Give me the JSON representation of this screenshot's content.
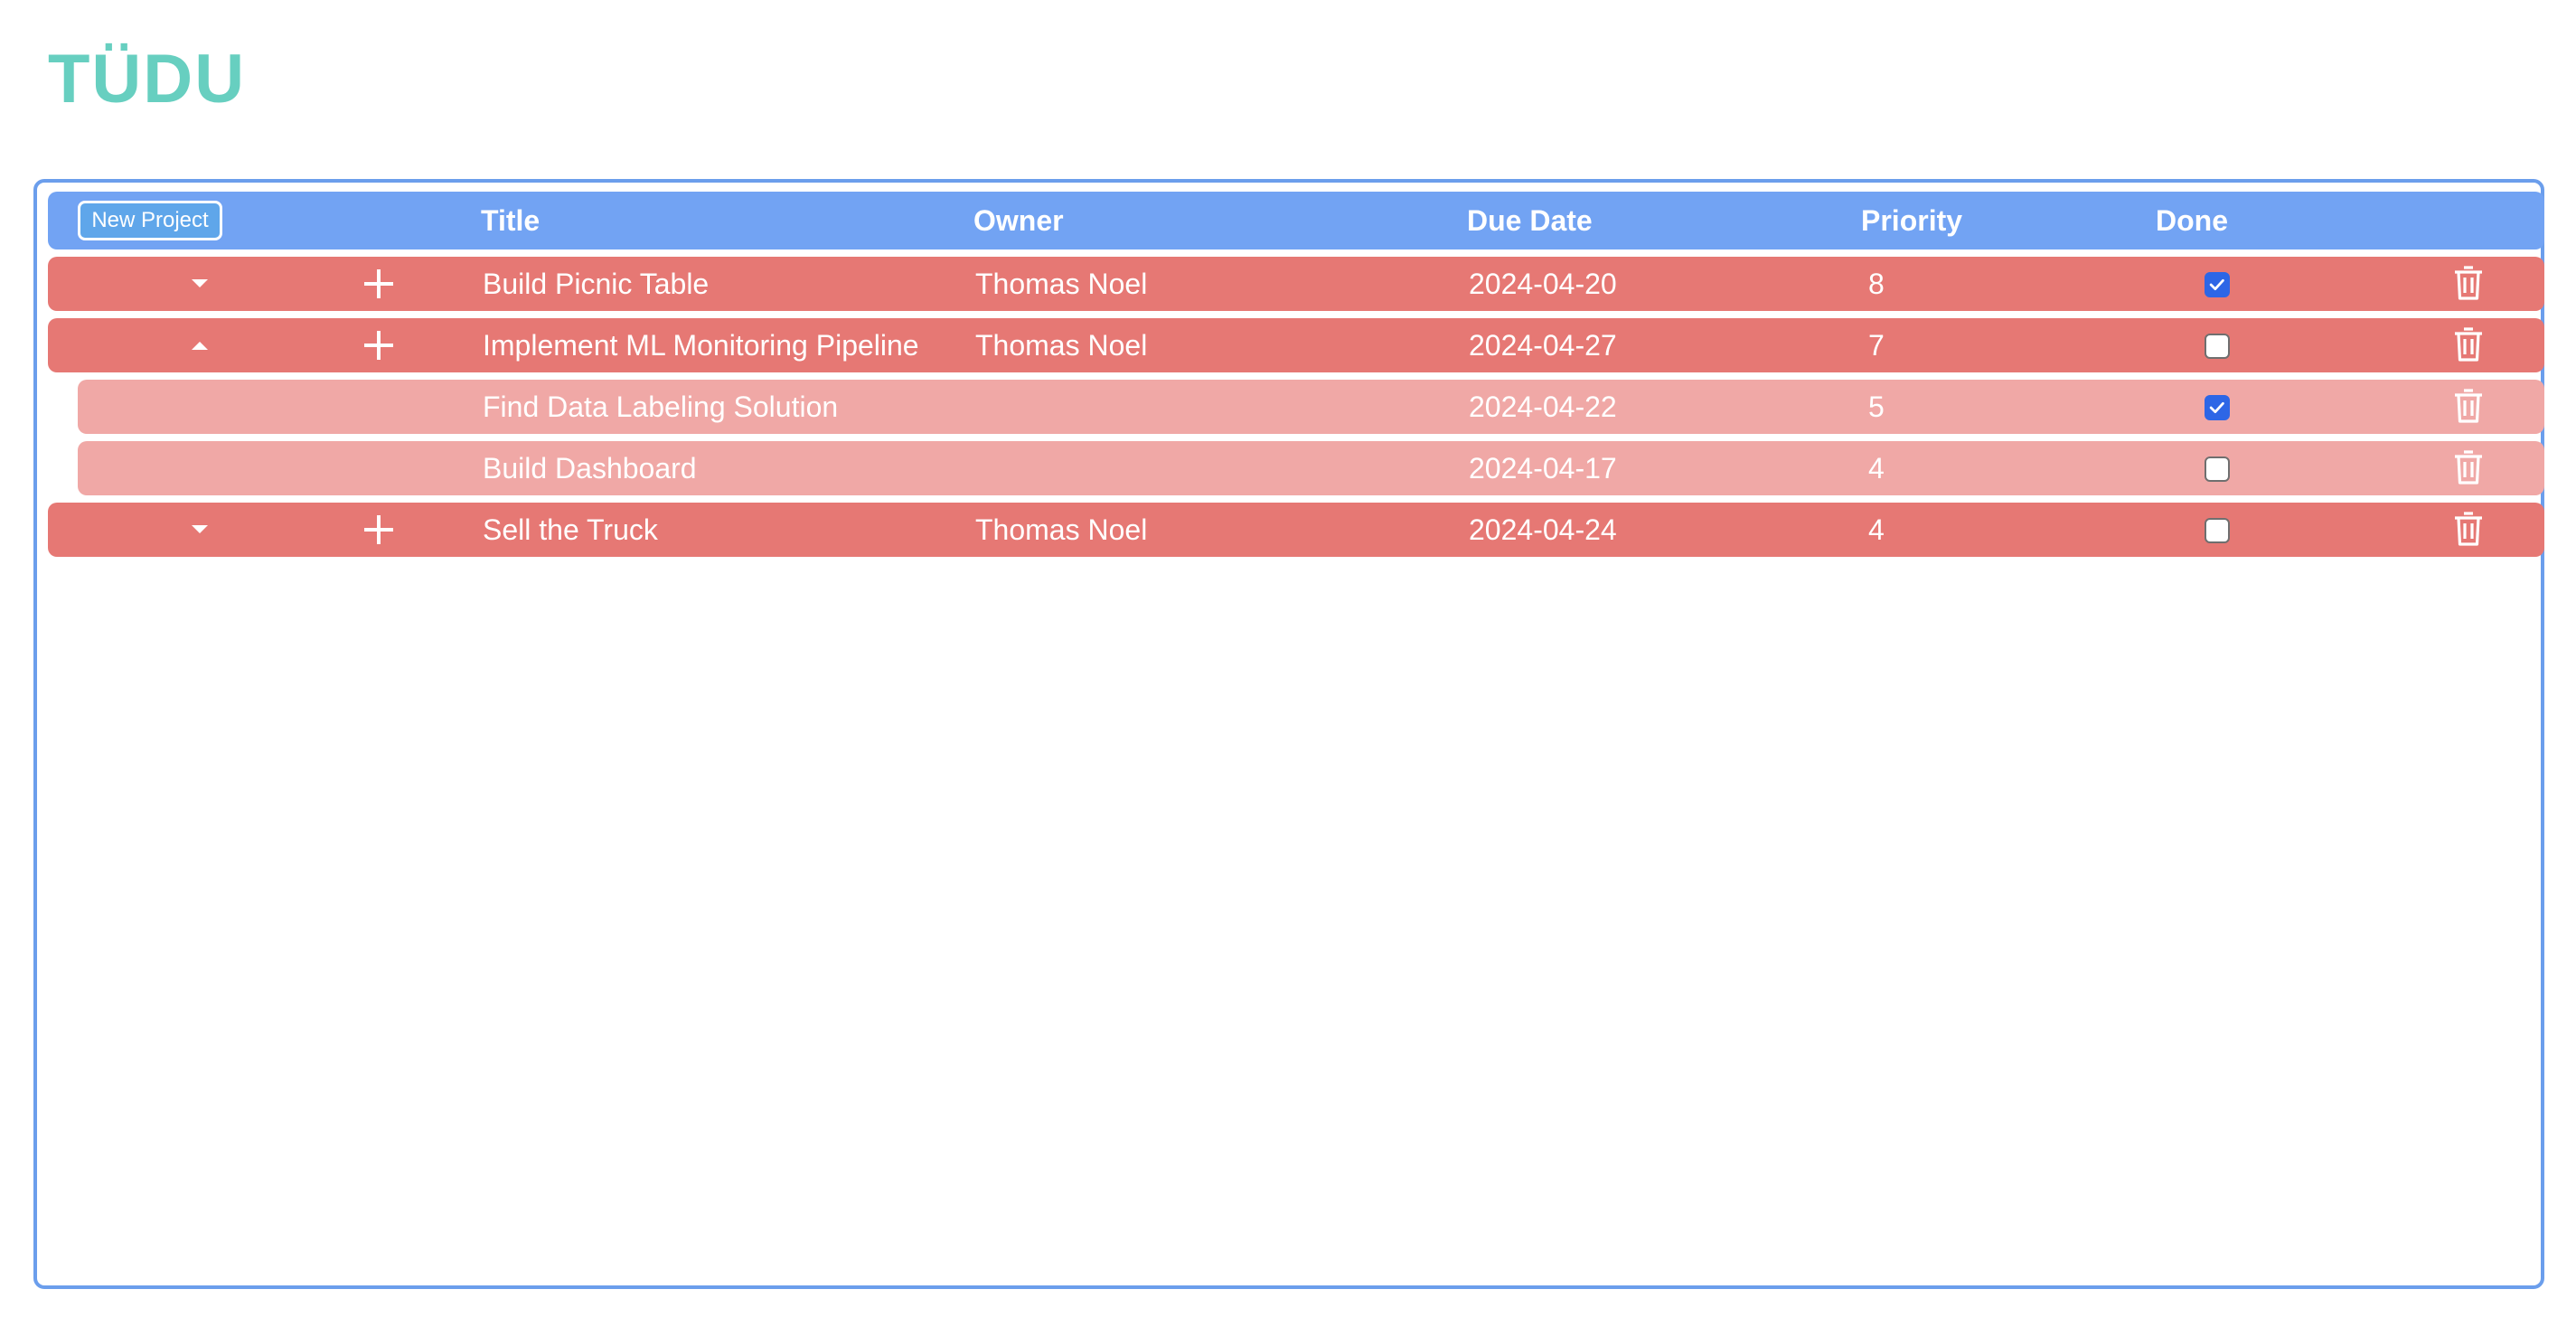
{
  "app": {
    "title": "TÜDU"
  },
  "table": {
    "new_project_label": "New Project",
    "columns": {
      "title": "Title",
      "owner": "Owner",
      "due_date": "Due Date",
      "priority": "Priority",
      "done": "Done"
    },
    "rows": [
      {
        "kind": "project",
        "expanded": false,
        "title": "Build Picnic Table",
        "owner": "Thomas Noel",
        "due_date": "2024-04-20",
        "priority": "8",
        "done": true
      },
      {
        "kind": "project",
        "expanded": true,
        "title": "Implement ML Monitoring Pipeline",
        "owner": "Thomas Noel",
        "due_date": "2024-04-27",
        "priority": "7",
        "done": false
      },
      {
        "kind": "task",
        "title": "Find Data Labeling Solution",
        "owner": "",
        "due_date": "2024-04-22",
        "priority": "5",
        "done": true
      },
      {
        "kind": "task",
        "title": "Build Dashboard",
        "owner": "",
        "due_date": "2024-04-17",
        "priority": "4",
        "done": false
      },
      {
        "kind": "project",
        "expanded": false,
        "title": "Sell the Truck",
        "owner": "Thomas Noel",
        "due_date": "2024-04-24",
        "priority": "4",
        "done": false
      }
    ]
  },
  "icons": {
    "expand": "chevron-down-icon",
    "collapse": "chevron-up-icon",
    "add": "plus-icon",
    "delete": "trash-icon"
  },
  "colors": {
    "title": "#67cfc0",
    "header": "#72a3f3",
    "border": "#6b9eec",
    "project_row": "#e67874",
    "task_row": "#f0a8a6",
    "checkbox_checked": "#2d66e6"
  }
}
